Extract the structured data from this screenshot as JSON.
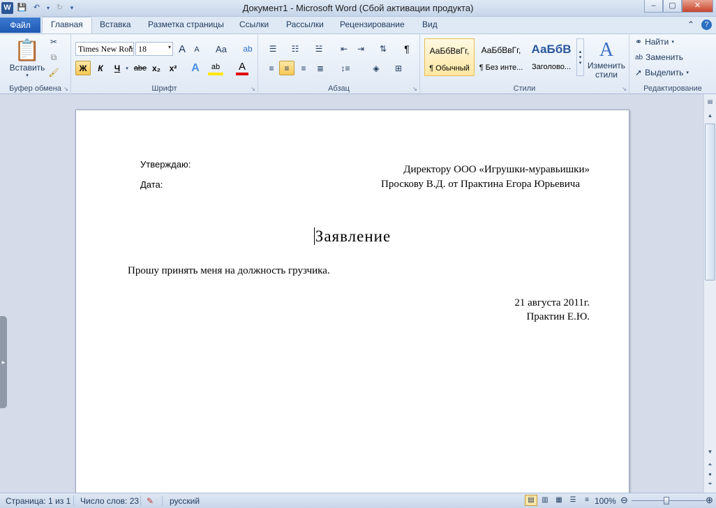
{
  "window": {
    "title": "Документ1  -  Microsoft Word (Сбой активации продукта)",
    "min": "–",
    "max": "▢",
    "close": "✕"
  },
  "tabs": {
    "file": "Файл",
    "home": "Главная",
    "insert": "Вставка",
    "layout": "Разметка страницы",
    "references": "Ссылки",
    "mailings": "Рассылки",
    "review": "Рецензирование",
    "view": "Вид"
  },
  "ribbon": {
    "clipboard": {
      "label": "Буфер обмена",
      "paste": "Вставить"
    },
    "font": {
      "label": "Шрифт",
      "font_name": "Times New Roman",
      "font_size": "18",
      "grow": "A",
      "shrink": "A",
      "case": "Aa",
      "bold": "Ж",
      "italic": "К",
      "underline": "Ч",
      "strike": "abe",
      "subscript": "x₂",
      "superscript": "x²",
      "effects": "A",
      "highlight": "ab",
      "color": "A"
    },
    "paragraph": {
      "label": "Абзац",
      "pilcrow": "¶"
    },
    "styles": {
      "label": "Стили",
      "items": [
        {
          "preview": "АаБбВвГг,",
          "name": "¶ Обычный"
        },
        {
          "preview": "АаБбВвГг,",
          "name": "¶ Без инте..."
        },
        {
          "preview": "АаБбВ",
          "name": "Заголово..."
        }
      ],
      "change": "Изменить стили"
    },
    "editing": {
      "label": "Редактирование",
      "find": "Найти",
      "replace": "Заменить",
      "select": "Выделить"
    }
  },
  "document": {
    "approve_label": "Утверждаю:",
    "date_label": "Дата:",
    "addressee_line1": "Директору  ООО  «Игрушки-муравьишки»",
    "addressee_line2": "Проскову В.Д. от Практина Егора Юрьевича",
    "heading": "Заявление",
    "body": "Прошу принять меня на должность грузчика.",
    "date": "21 августа 2011г.",
    "signature": "Практин Е.Ю."
  },
  "status": {
    "page": "Страница: 1 из 1",
    "words": "Число слов: 23",
    "language": "русский",
    "zoom": "100%"
  },
  "accent_color": "#2b579a"
}
